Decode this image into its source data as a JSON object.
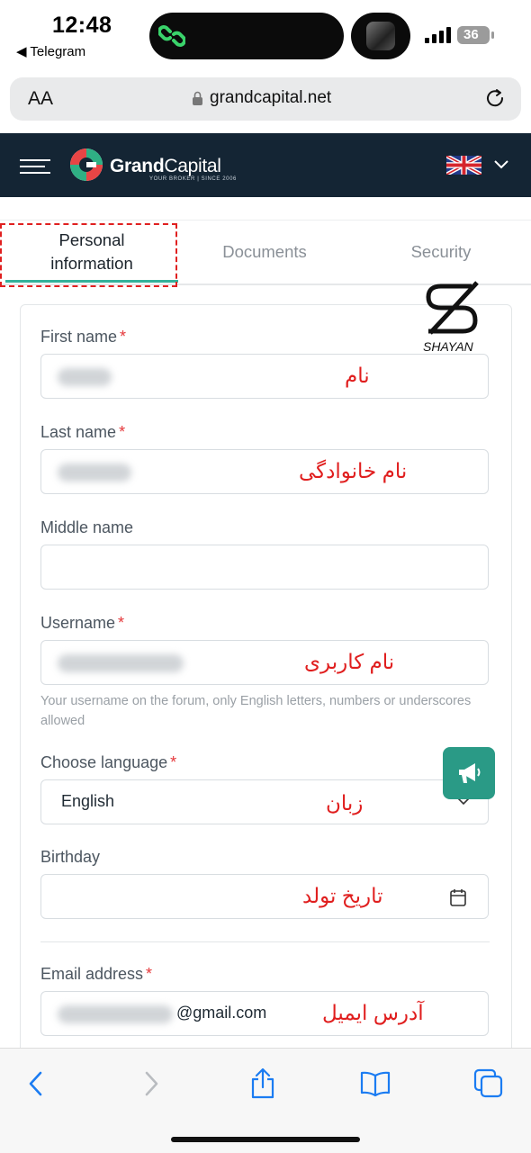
{
  "status_bar": {
    "time": "12:48",
    "back_app": "◀ Telegram",
    "battery": "36"
  },
  "browser": {
    "text_size": "AA",
    "url": "grandcapital.net"
  },
  "header": {
    "brand_bold": "Grand",
    "brand_light": "Capital",
    "brand_tagline": "YOUR BROKER  |  SINCE 2006"
  },
  "tabs": [
    {
      "label": "Personal information",
      "active": true
    },
    {
      "label": "Documents",
      "active": false
    },
    {
      "label": "Security",
      "active": false
    }
  ],
  "form": {
    "first_name": {
      "label": "First name",
      "required": "*",
      "annotation": "نام"
    },
    "last_name": {
      "label": "Last name",
      "required": "*",
      "annotation": "نام خانوادگی"
    },
    "middle_name": {
      "label": "Middle name",
      "value": ""
    },
    "username": {
      "label": "Username",
      "required": "*",
      "annotation": "نام کاربری",
      "hint": "Your username on the forum, only English letters, numbers or underscores allowed"
    },
    "language": {
      "label": "Choose language",
      "required": "*",
      "value": "English",
      "annotation": "زبان"
    },
    "birthday": {
      "label": "Birthday",
      "annotation": "تاریخ تولد"
    },
    "email": {
      "label": "Email address",
      "required": "*",
      "value_suffix": "@gmail.com",
      "annotation": "آدرس ایمیل"
    }
  },
  "watermark": {
    "text": "SHAYAN"
  },
  "colors": {
    "header_bg": "#142534",
    "accent": "#33b19a",
    "fab": "#2a9a86",
    "annotation_red": "#e01e1e",
    "required_red": "#e5383b"
  },
  "icons": [
    "hamburger-icon",
    "grandcapital-logo",
    "uk-flag-icon",
    "chevron-down-icon",
    "calendar-icon",
    "megaphone-icon",
    "back-icon",
    "forward-icon",
    "share-icon",
    "bookmarks-icon",
    "tabs-icon",
    "reload-icon",
    "lock-icon"
  ]
}
